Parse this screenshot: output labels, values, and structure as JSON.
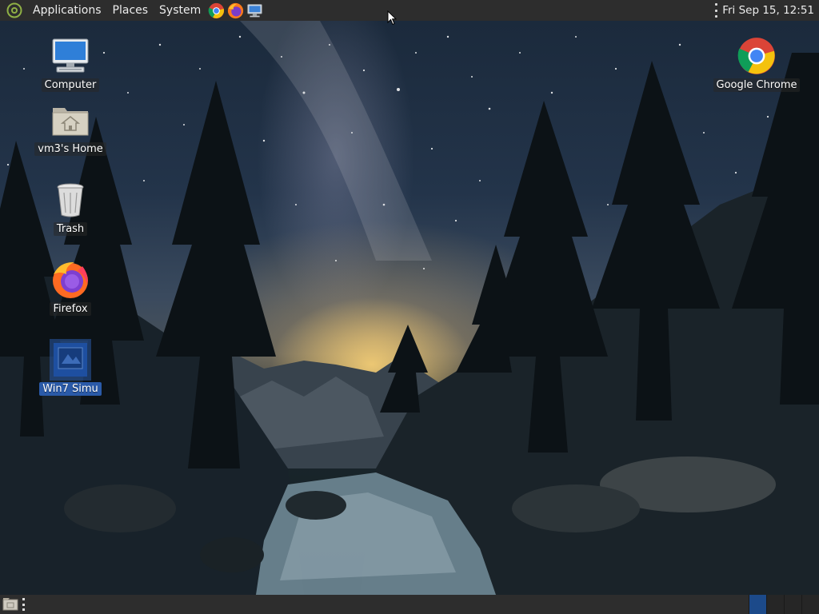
{
  "top_panel": {
    "menus": [
      {
        "label": "Applications"
      },
      {
        "label": "Places"
      },
      {
        "label": "System"
      }
    ],
    "launchers": [
      {
        "icon": "chrome-icon"
      },
      {
        "icon": "firefox-icon"
      },
      {
        "icon": "computer-icon"
      }
    ],
    "clock": "Fri Sep 15, 12:51"
  },
  "desktop_icons": [
    {
      "label": "Computer",
      "icon": "computer-icon"
    },
    {
      "label": "vm3's Home",
      "icon": "home-folder-icon"
    },
    {
      "label": "Trash",
      "icon": "trash-icon"
    },
    {
      "label": "Firefox",
      "icon": "firefox-icon"
    },
    {
      "label": "Win7 Simu",
      "icon": "win7-simu-icon",
      "selected": true
    },
    {
      "label": "Google Chrome",
      "icon": "chrome-icon"
    }
  ],
  "bottom_panel": {
    "workspaces": 4,
    "active_workspace": 1
  },
  "colors": {
    "panel": "#2d2d2d",
    "selection": "#2a5aa8",
    "active_workspace": "#1c4a8a"
  }
}
